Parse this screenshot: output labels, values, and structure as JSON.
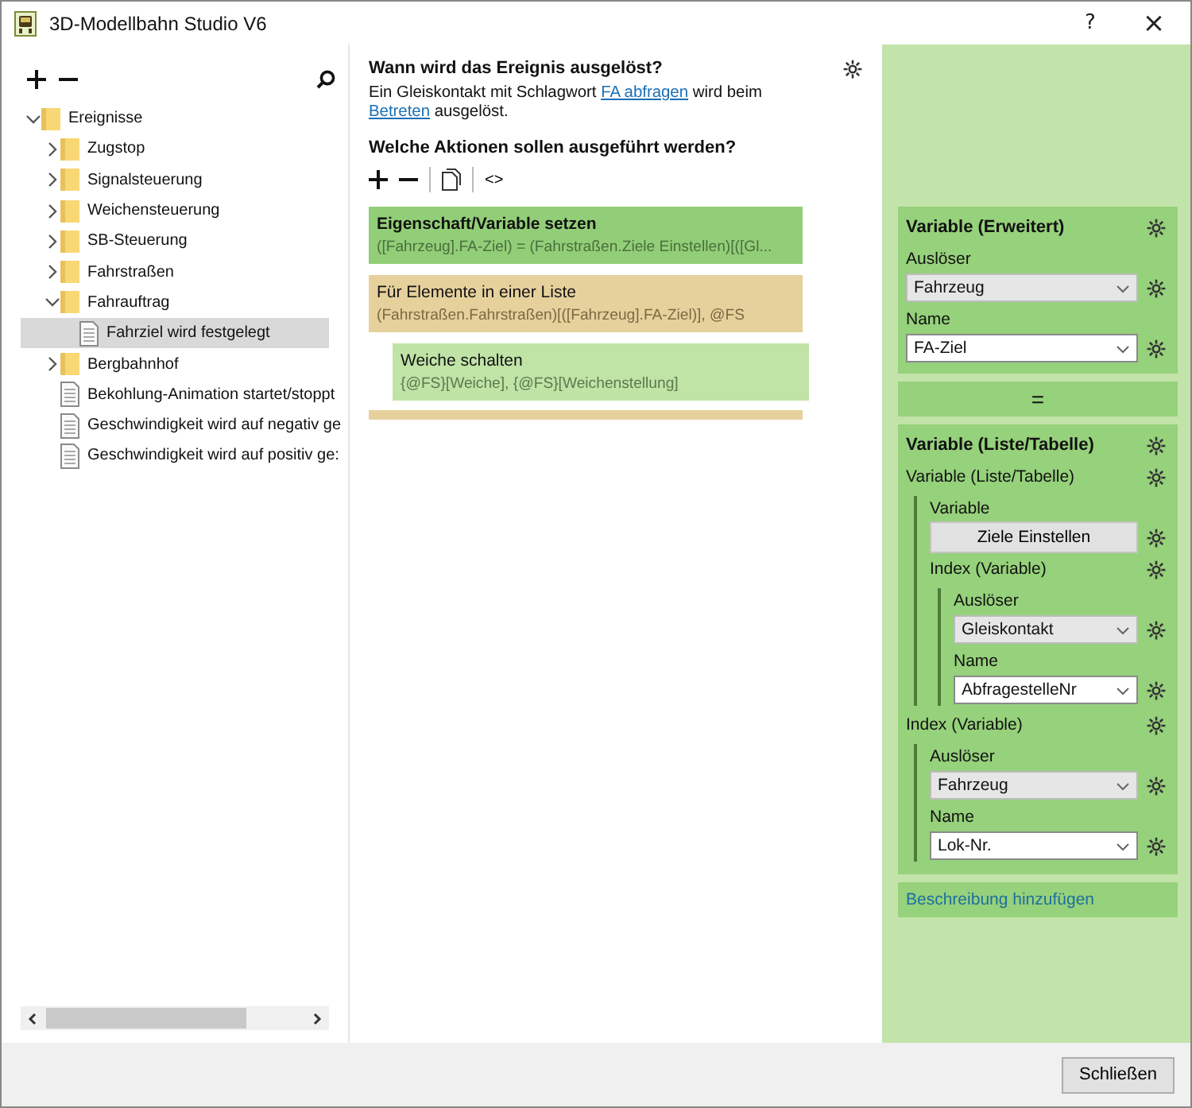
{
  "window": {
    "title": "3D-Modellbahn Studio V6",
    "help": "?",
    "close": "×"
  },
  "tree": [
    {
      "label": "Ereignisse",
      "kind": "folder",
      "expanded": true,
      "selected": false,
      "children": [
        {
          "label": "Zugstop",
          "kind": "folder",
          "expanded": false,
          "selected": false
        },
        {
          "label": "Signalsteuerung",
          "kind": "folder",
          "expanded": false,
          "selected": false
        },
        {
          "label": "Weichensteuerung",
          "kind": "folder",
          "expanded": false,
          "selected": false
        },
        {
          "label": "SB-Steuerung",
          "kind": "folder",
          "expanded": false,
          "selected": false
        },
        {
          "label": "Fahrstraßen",
          "kind": "folder",
          "expanded": false,
          "selected": false
        },
        {
          "label": "Fahrauftrag",
          "kind": "folder",
          "expanded": true,
          "selected": false,
          "children": [
            {
              "label": "Fahrziel wird festgelegt",
              "kind": "document",
              "selected": true
            }
          ]
        },
        {
          "label": "Bergbahnhof",
          "kind": "folder",
          "expanded": false,
          "selected": false
        },
        {
          "label": "Bekohlung-Animation startet/stoppt",
          "kind": "document",
          "selected": false
        },
        {
          "label": "Geschwindigkeit wird auf negativ ge",
          "kind": "document",
          "selected": false
        },
        {
          "label": "Geschwindigkeit wird auf positiv ge:",
          "kind": "document",
          "selected": false
        }
      ]
    }
  ],
  "trigger": {
    "heading": "Wann wird das Ereignis ausgelöst?",
    "description": [
      {
        "kind": "text",
        "text": "Ein Gleiskontakt mit Schlagwort "
      },
      {
        "kind": "link",
        "text": "FA abfragen"
      },
      {
        "kind": "text",
        "text": " wird beim "
      },
      {
        "kind": "link",
        "text": "Betreten"
      },
      {
        "kind": "text",
        "text": " ausgelöst."
      }
    ]
  },
  "actions": {
    "heading": "Welche Aktionen sollen ausgeführt werden?",
    "code_button": "<>",
    "items": [
      {
        "kind": "set",
        "title": "Eigenschaft/Variable setzen",
        "detail": "([Fahrzeug].FA-Ziel) = (Fahrstraßen.Ziele Einstellen)[([Gl..."
      },
      {
        "kind": "loop",
        "title": "Für Elemente in einer Liste",
        "detail": "(Fahrstraßen.Fahrstraßen)[([Fahrzeug].FA-Ziel)], @FS",
        "children": [
          {
            "kind": "command",
            "title": "Weiche schalten",
            "detail": "{@FS}[Weiche], {@FS}[Weichenstellung]"
          }
        ]
      }
    ]
  },
  "properties": {
    "cards": [
      {
        "kind": "card",
        "title": "Variable (Erweitert)",
        "items": [
          {
            "kind": "label",
            "text": "Auslöser"
          },
          {
            "kind": "select",
            "value": "Fahrzeug"
          },
          {
            "kind": "label",
            "text": "Name"
          },
          {
            "kind": "combo",
            "value": "FA-Ziel"
          }
        ]
      },
      {
        "kind": "operator",
        "text": "="
      },
      {
        "kind": "card",
        "title": "Variable (Liste/Tabelle)",
        "items": [
          {
            "kind": "row",
            "text": "Variable (Liste/Tabelle)"
          },
          {
            "kind": "group",
            "items": [
              {
                "kind": "label",
                "text": "Variable"
              },
              {
                "kind": "button",
                "text": "Ziele Einstellen"
              },
              {
                "kind": "row",
                "text": "Index (Variable)"
              },
              {
                "kind": "group",
                "items": [
                  {
                    "kind": "label",
                    "text": "Auslöser"
                  },
                  {
                    "kind": "select",
                    "value": "Gleiskontakt"
                  },
                  {
                    "kind": "label",
                    "text": "Name"
                  },
                  {
                    "kind": "combo",
                    "value": "AbfragestelleNr"
                  }
                ]
              }
            ]
          },
          {
            "kind": "row",
            "text": "Index (Variable)"
          },
          {
            "kind": "group",
            "items": [
              {
                "kind": "label",
                "text": "Auslöser"
              },
              {
                "kind": "select",
                "value": "Fahrzeug"
              },
              {
                "kind": "label",
                "text": "Name"
              },
              {
                "kind": "combo",
                "value": "Lok-Nr."
              }
            ]
          }
        ]
      },
      {
        "kind": "link",
        "text": "Beschreibung hinzufügen"
      }
    ]
  },
  "footer": {
    "close_button": "Schließen"
  }
}
